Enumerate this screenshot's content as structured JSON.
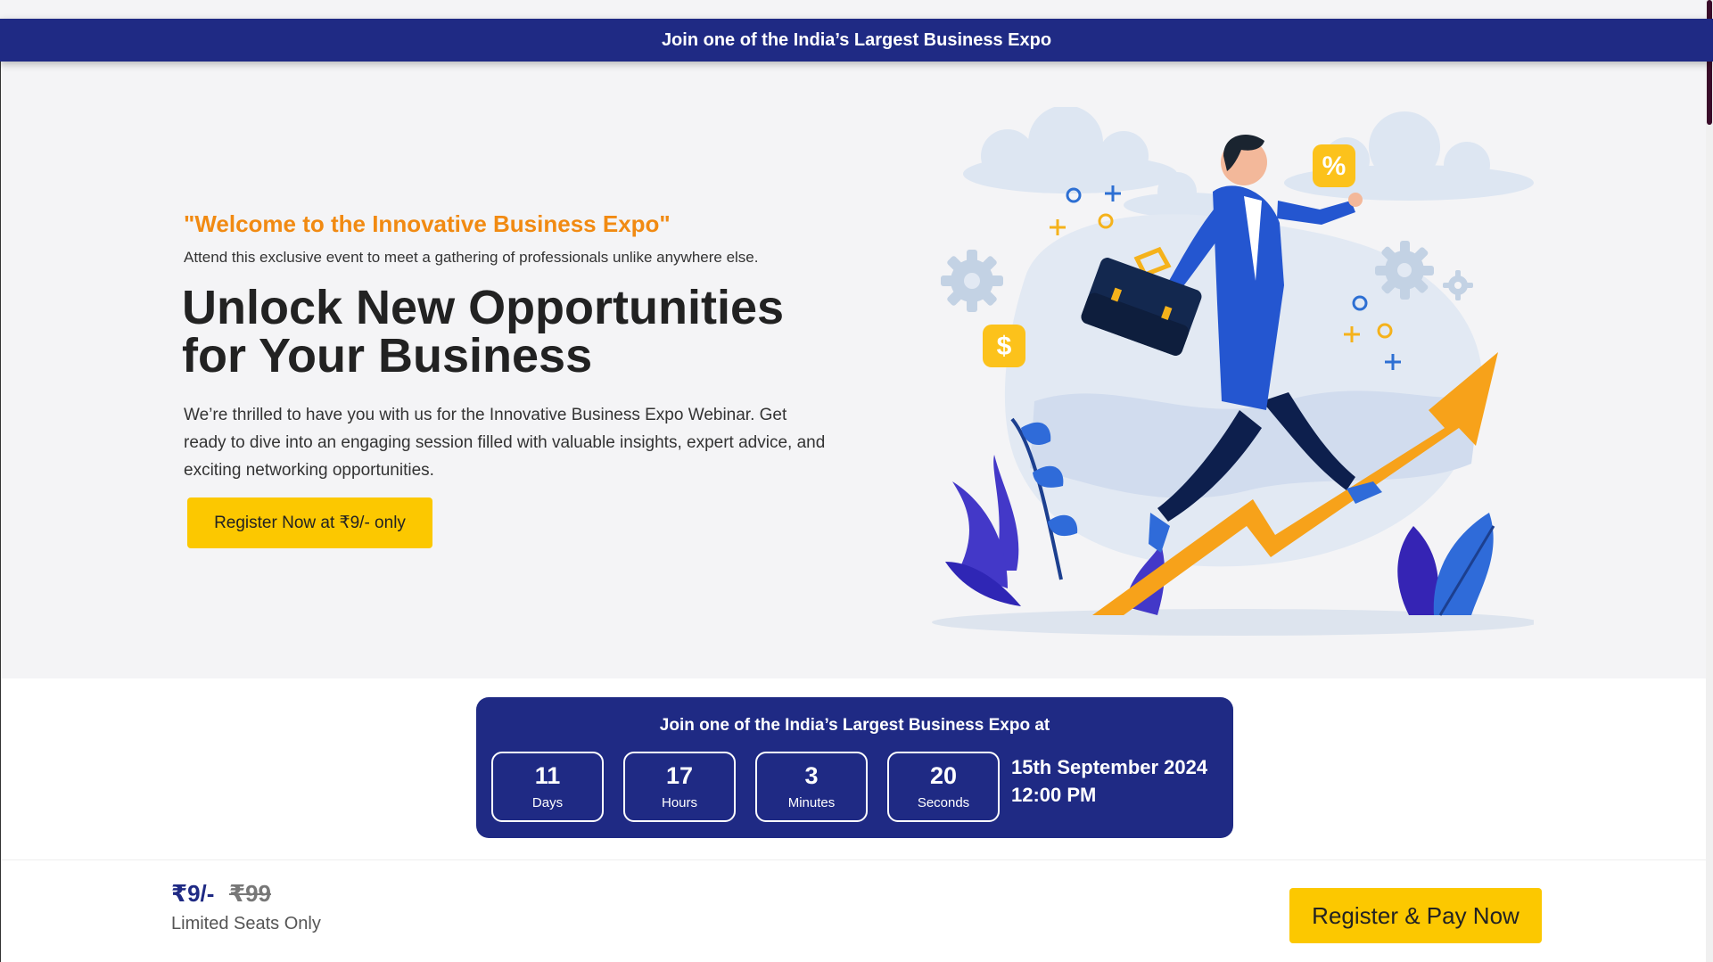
{
  "banner": {
    "text": "Join one of the India’s Largest Business Expo"
  },
  "hero": {
    "welcome": "\"Welcome to the Innovative Business Expo\"",
    "attend": "Attend this exclusive event to meet a gathering of professionals unlike anywhere else.",
    "headline": "Unlock New Opportunities for Your Business",
    "description": "We’re thrilled to have you with us for the Innovative Business Expo Webinar. Get ready to dive into an engaging session filled with valuable insights, expert advice, and exciting networking opportunities.",
    "cta_label": "Register Now at ₹9/- only",
    "illustration_icons": [
      "percent-badge-icon",
      "dollar-badge-icon",
      "gear-icon",
      "briefcase-icon",
      "growth-arrow-icon"
    ]
  },
  "countdown": {
    "title": "Join one of the India’s Largest Business Expo at",
    "units": [
      {
        "value": "11",
        "label": "Days"
      },
      {
        "value": "17",
        "label": "Hours"
      },
      {
        "value": "3",
        "label": "Minutes"
      },
      {
        "value": "20",
        "label": "Seconds"
      }
    ],
    "date": "15th September 2024",
    "time": "12:00 PM"
  },
  "footer": {
    "price_now": "₹9/-",
    "price_old": "₹99",
    "limited": "Limited Seats Only",
    "pay_label": "Register & Pay Now"
  },
  "colors": {
    "navy": "#1f2a84",
    "accent_yellow": "#fcc800",
    "accent_orange": "#f18a12"
  }
}
